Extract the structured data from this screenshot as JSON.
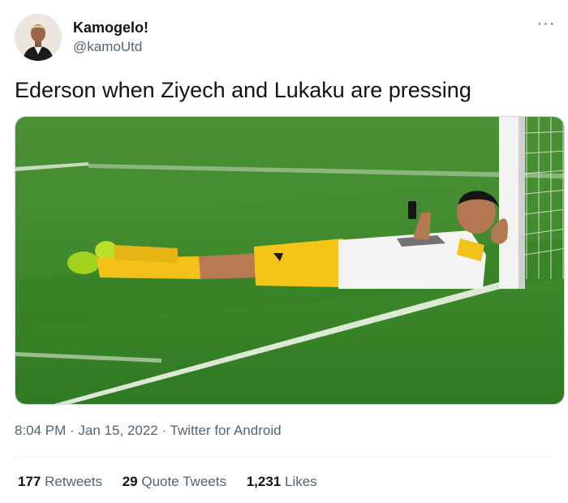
{
  "author": {
    "display_name": "Kamogelo!",
    "handle": "@kamoUtd"
  },
  "more_label": "···",
  "tweet": {
    "text": "Ederson when Ziyech and Lukaku are pressing"
  },
  "meta": {
    "time": "8:04 PM",
    "sep1": " · ",
    "date": "Jan 15, 2022",
    "sep2": " · ",
    "source": "Twitter for Android"
  },
  "stats": {
    "retweets": {
      "count": "177",
      "label": "Retweets"
    },
    "quotes": {
      "count": "29",
      "label": "Quote Tweets"
    },
    "likes": {
      "count": "1,231",
      "label": "Likes"
    }
  },
  "colors": {
    "text_primary": "#0f1419",
    "text_secondary": "#536471",
    "pitch_green": "#3f8a2c",
    "kit_yellow": "#f2c11a"
  }
}
